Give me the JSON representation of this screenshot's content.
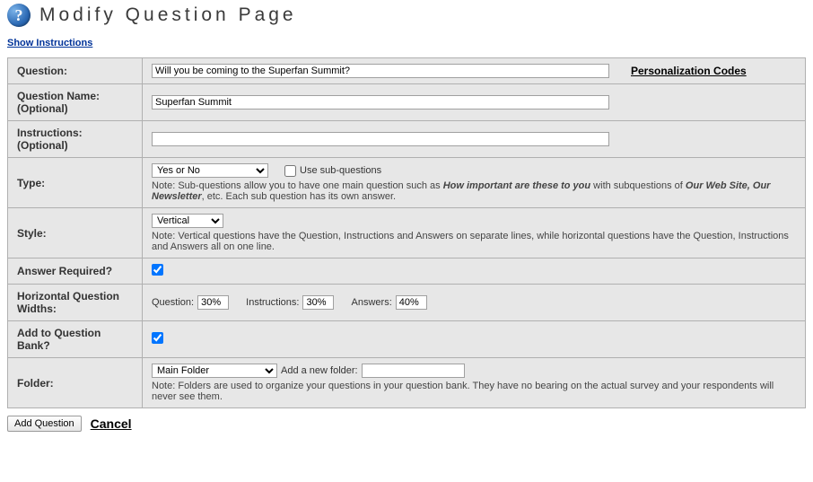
{
  "header": {
    "title": "Modify Question Page",
    "help_icon_symbol": "?"
  },
  "links": {
    "show_instructions": "Show Instructions",
    "personalization_codes": "Personalization Codes",
    "cancel": "Cancel"
  },
  "labels": {
    "question": "Question:",
    "question_name": "Question Name: (Optional)",
    "instructions": "Instructions: (Optional)",
    "type": "Type:",
    "style": "Style:",
    "answer_required": "Answer Required?",
    "horizontal_widths": "Horizontal Question Widths:",
    "add_to_bank": "Add to Question Bank?",
    "folder": "Folder:"
  },
  "fields": {
    "question_value": "Will you be coming to the Superfan Summit?",
    "question_name_value": "Superfan Summit",
    "instructions_value": "",
    "type_selected": "Yes or No",
    "use_sub_questions_checked": false,
    "use_sub_questions_label": "Use sub-questions",
    "type_note_prefix": "Note: Sub-questions allow you to have one main question such as ",
    "type_note_em1": "How important are these to you",
    "type_note_mid": " with subquestions of ",
    "type_note_em2": "Our Web Site, Our Newsletter",
    "type_note_suffix": ", etc. Each sub question has its own answer.",
    "style_selected": "Vertical",
    "style_note": "Note: Vertical questions have the Question, Instructions and Answers on separate lines, while horizontal questions have the Question, Instructions and Answers all on one line.",
    "answer_required_checked": true,
    "hw_question_label": "Question:",
    "hw_question_value": "30%",
    "hw_instructions_label": "Instructions:",
    "hw_instructions_value": "30%",
    "hw_answers_label": "Answers:",
    "hw_answers_value": "40%",
    "add_to_bank_checked": true,
    "folder_selected": "Main Folder",
    "add_new_folder_label": "Add a new folder:",
    "add_new_folder_value": "",
    "folder_note": "Note: Folders are used to organize your questions in your question bank. They have no bearing on the actual survey and your respondents will never see them."
  },
  "buttons": {
    "add_question": "Add Question"
  }
}
